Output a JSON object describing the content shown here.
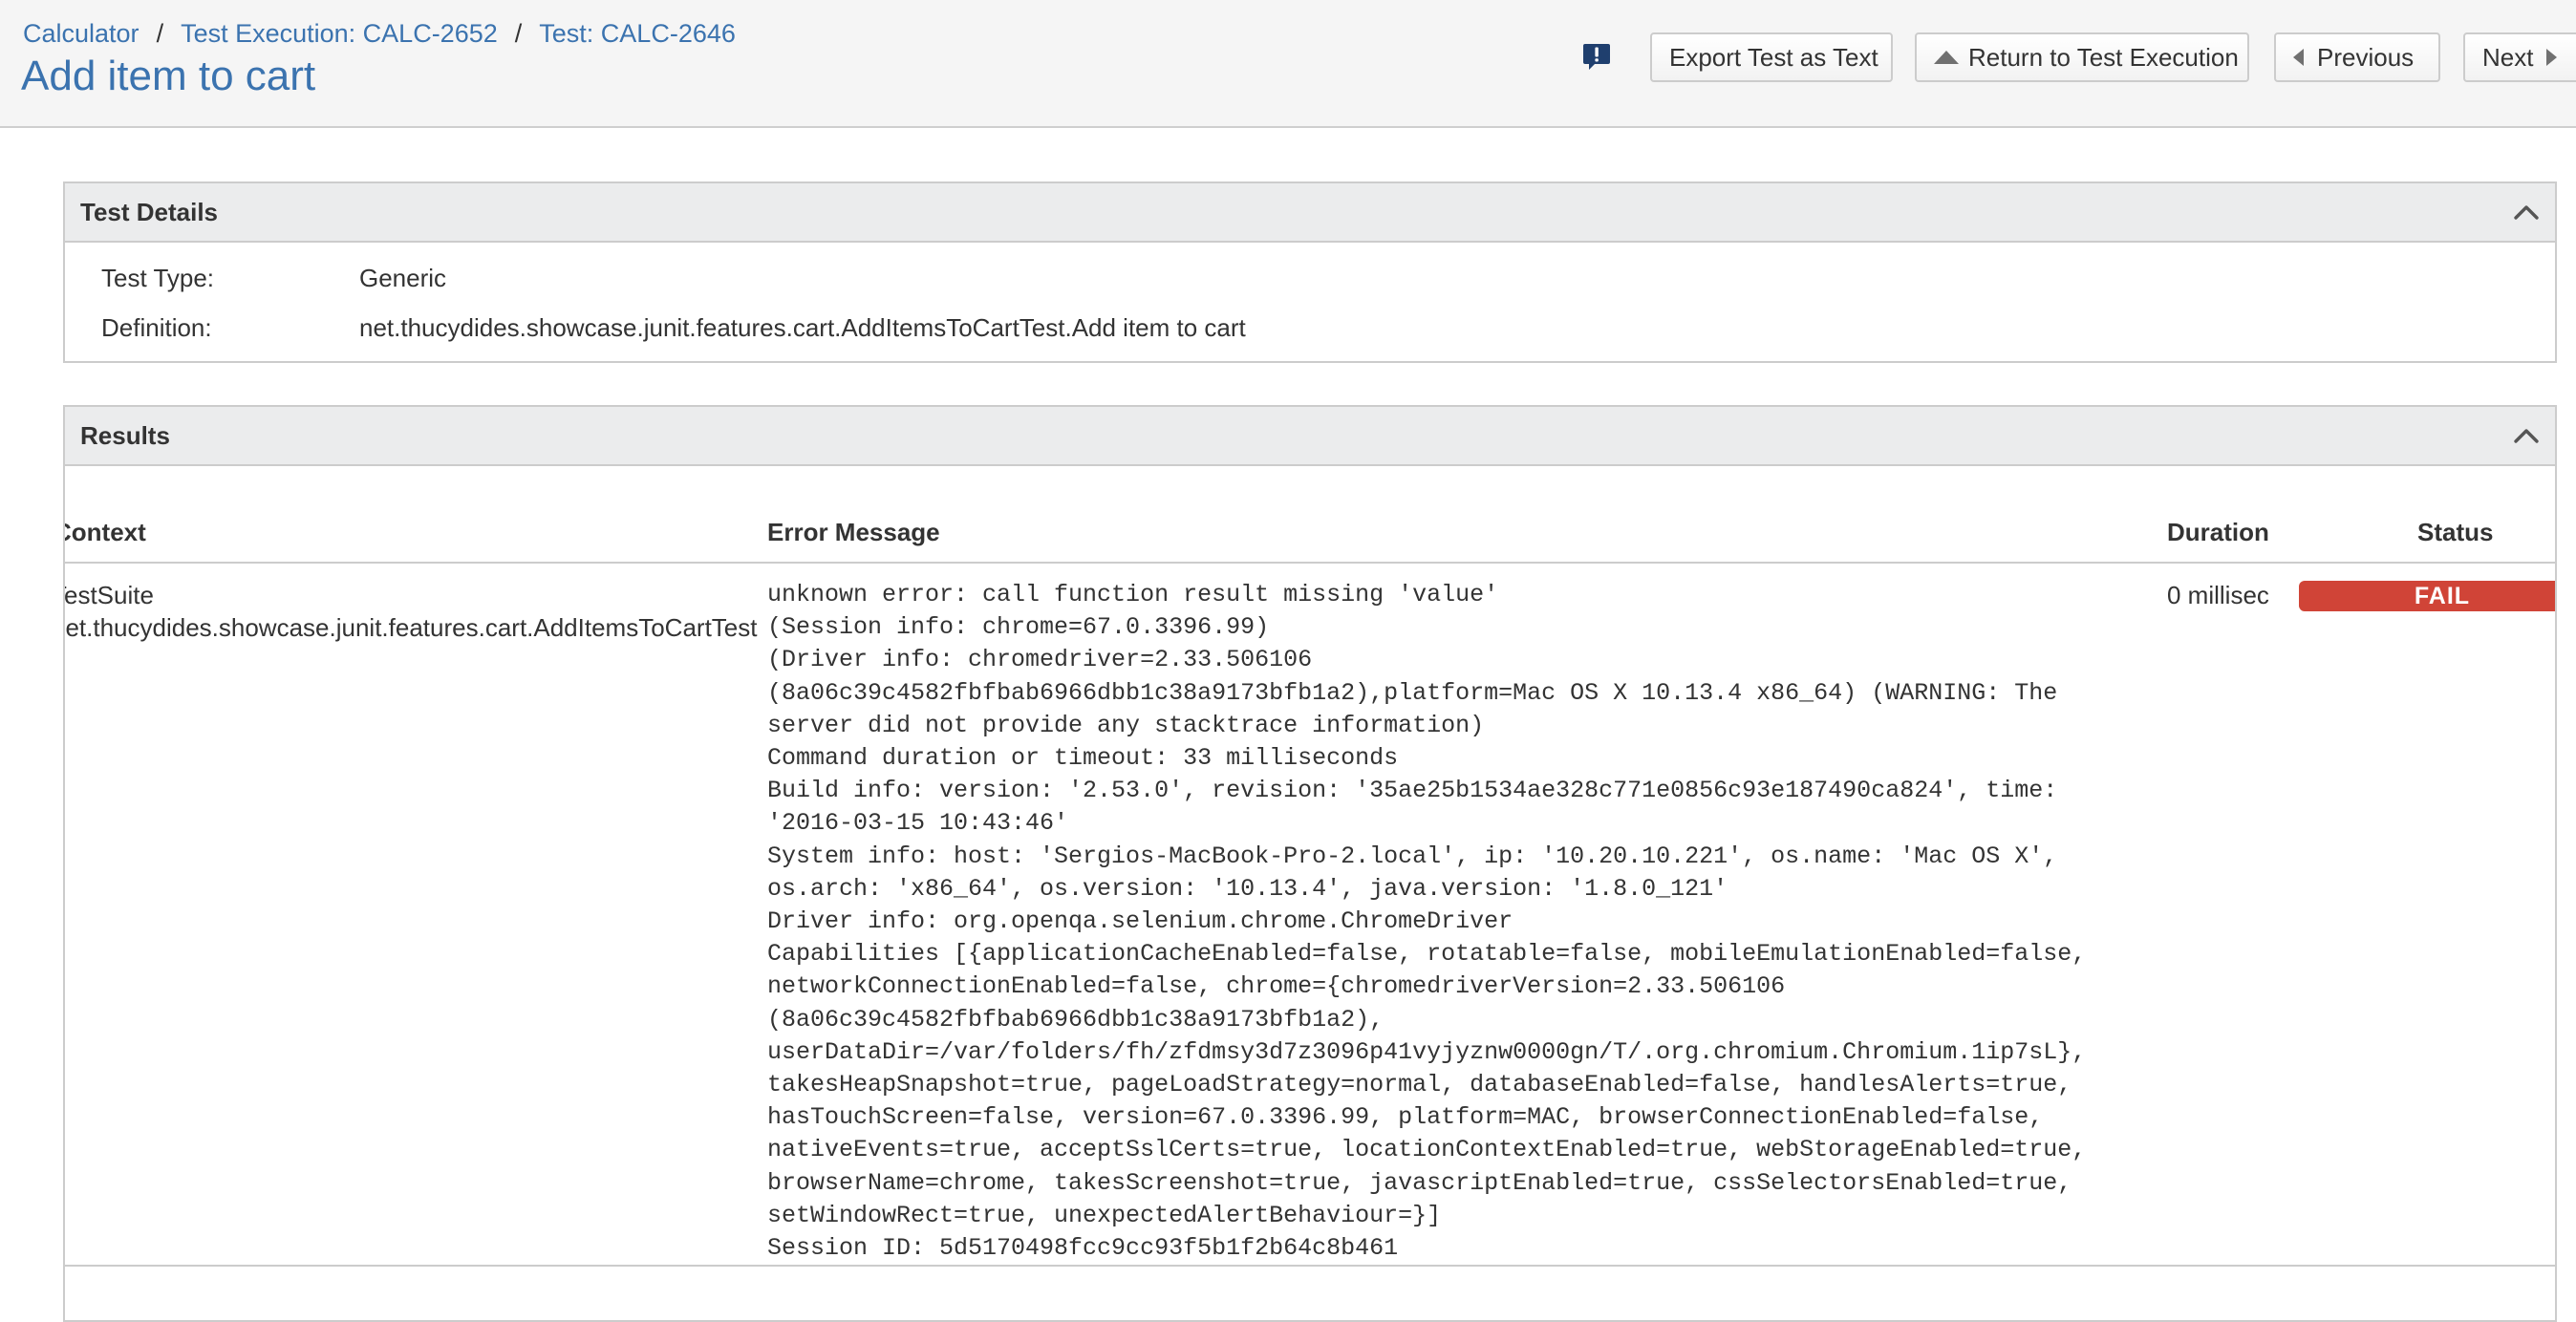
{
  "breadcrumb": {
    "project": "Calculator",
    "execution": "Test Execution: CALC-2652",
    "test": "Test: CALC-2646",
    "separator": "/"
  },
  "page": {
    "title": "Add item to cart"
  },
  "toolbar": {
    "feedback_icon": "feedback-exclamation-icon",
    "export_label": "Export Test as Text",
    "return_label": "Return to Test Execution",
    "previous_label": "Previous",
    "next_label": "Next"
  },
  "details": {
    "title": "Test Details",
    "type_label": "Test Type:",
    "type_value": "Generic",
    "definition_label": "Definition:",
    "definition_value": "net.thucydides.showcase.junit.features.cart.AddItemsToCartTest.Add item to cart"
  },
  "results": {
    "title": "Results",
    "columns": {
      "context": "Context",
      "error": "Error Message",
      "duration": "Duration",
      "status": "Status"
    },
    "rows": [
      {
        "context_line1": "TestSuite",
        "context_line2": "net.thucydides.showcase.junit.features.cart.AddItemsToCartTest",
        "error": "unknown error: call function result missing 'value'\n(Session info: chrome=67.0.3396.99)\n(Driver info: chromedriver=2.33.506106\n(8a06c39c4582fbfbab6966dbb1c38a9173bfb1a2),platform=Mac OS X 10.13.4 x86_64) (WARNING: The\nserver did not provide any stacktrace information)\nCommand duration or timeout: 33 milliseconds\nBuild info: version: '2.53.0', revision: '35ae25b1534ae328c771e0856c93e187490ca824', time:\n'2016-03-15 10:43:46'\nSystem info: host: 'Sergios-MacBook-Pro-2.local', ip: '10.20.10.221', os.name: 'Mac OS X',\nos.arch: 'x86_64', os.version: '10.13.4', java.version: '1.8.0_121'\nDriver info: org.openqa.selenium.chrome.ChromeDriver\nCapabilities [{applicationCacheEnabled=false, rotatable=false, mobileEmulationEnabled=false,\nnetworkConnectionEnabled=false, chrome={chromedriverVersion=2.33.506106\n(8a06c39c4582fbfbab6966dbb1c38a9173bfb1a2),\nuserDataDir=/var/folders/fh/zfdmsy3d7z3096p41vyjyznw0000gn/T/.org.chromium.Chromium.1ip7sL},\ntakesHeapSnapshot=true, pageLoadStrategy=normal, databaseEnabled=false, handlesAlerts=true,\nhasTouchScreen=false, version=67.0.3396.99, platform=MAC, browserConnectionEnabled=false,\nnativeEvents=true, acceptSslCerts=true, locationContextEnabled=true, webStorageEnabled=true,\nbrowserName=chrome, takesScreenshot=true, javascriptEnabled=true, cssSelectorsEnabled=true,\nsetWindowRect=true, unexpectedAlertBehaviour=}]\nSession ID: 5d5170498fcc9cc93f5b1f2b64c8b461",
        "duration": "0 millisec",
        "status": "FAIL"
      }
    ]
  },
  "colors": {
    "link": "#3b73af",
    "fail": "#d04437",
    "header_bg": "#f5f5f5",
    "panel_head_bg": "#ebeced"
  },
  "icons": {
    "collapse": "chevron-up-icon",
    "return": "triangle-up-icon",
    "previous": "triangle-left-icon",
    "next": "triangle-right-icon"
  }
}
